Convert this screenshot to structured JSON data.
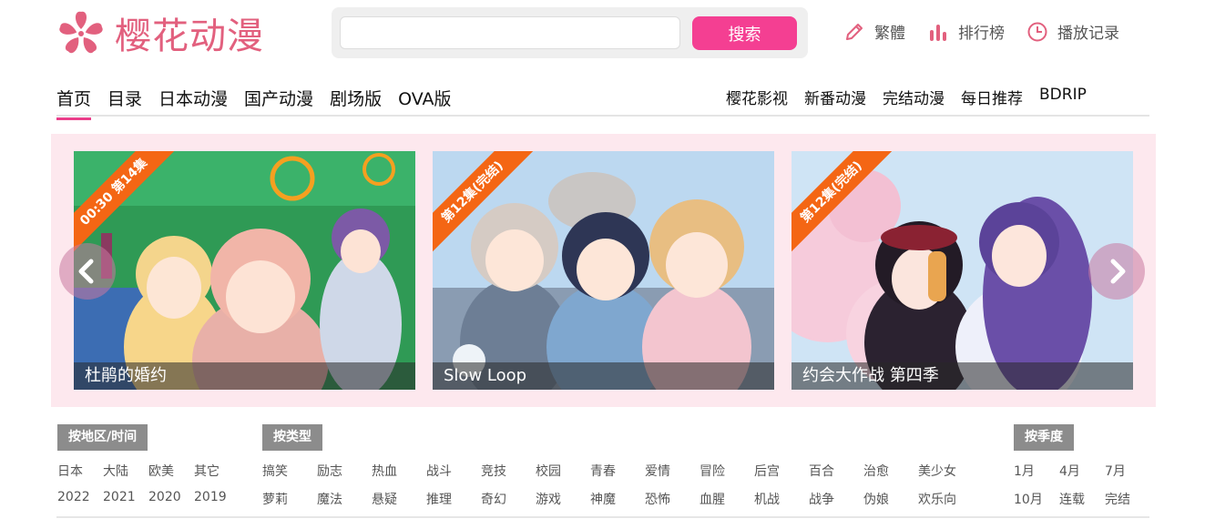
{
  "brand": {
    "name": "樱花动漫",
    "color": "#e2607e",
    "logo_icon": "sakura-flower-icon"
  },
  "search": {
    "value": "",
    "placeholder": "",
    "button_label": "搜索",
    "button_color": "#f43f92"
  },
  "top_links": [
    {
      "label": "繁體",
      "icon": "pencil-icon"
    },
    {
      "label": "排行榜",
      "icon": "bar-chart-icon"
    },
    {
      "label": "播放记录",
      "icon": "clock-icon"
    }
  ],
  "nav_left": [
    "首页",
    "目录",
    "日本动漫",
    "国产动漫",
    "剧场版",
    "OVA版"
  ],
  "nav_right": [
    "樱花影视",
    "新番动漫",
    "完结动漫",
    "每日推荐",
    "BDRIP"
  ],
  "nav_active": "首页",
  "accent": "#ea3d8a",
  "carousel": {
    "background": "#fde8ee",
    "slides": [
      {
        "title": "杜鹃的婚约",
        "badge": "00:30 第14集"
      },
      {
        "title": "Slow Loop",
        "badge": "第12集(完结)"
      },
      {
        "title": "约会大作战 第四季",
        "badge": "第12集(完结)"
      }
    ],
    "prev_icon": "chevron-left-icon",
    "next_icon": "chevron-right-icon"
  },
  "filters": {
    "region": {
      "title": "按地区/时间",
      "rows": [
        [
          "日本",
          "大陆",
          "欧美",
          "其它"
        ],
        [
          "2022",
          "2021",
          "2020",
          "2019"
        ]
      ]
    },
    "genre": {
      "title": "按类型",
      "rows": [
        [
          "搞笑",
          "励志",
          "热血",
          "战斗",
          "竞技",
          "校园",
          "青春",
          "爱情",
          "冒险",
          "后宫",
          "百合",
          "治愈",
          "美少女"
        ],
        [
          "萝莉",
          "魔法",
          "悬疑",
          "推理",
          "奇幻",
          "游戏",
          "神魔",
          "恐怖",
          "血腥",
          "机战",
          "战争",
          "伪娘",
          "欢乐向"
        ]
      ]
    },
    "season": {
      "title": "按季度",
      "rows": [
        [
          "1月",
          "4月",
          "7月"
        ],
        [
          "10月",
          "连载",
          "完结"
        ]
      ]
    }
  }
}
